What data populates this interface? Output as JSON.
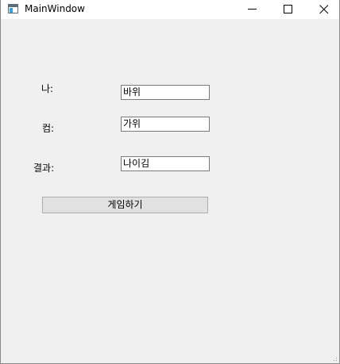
{
  "window": {
    "title": "MainWindow",
    "minimize_glyph": "minimize-icon",
    "maximize_glyph": "maximize-icon",
    "close_glyph": "close-icon"
  },
  "form": {
    "me_label": "나:",
    "me_value": "바위",
    "computer_label": "컴:",
    "computer_value": "가위",
    "result_label": "결과:",
    "result_value": "나이김",
    "play_button": "게임하기"
  }
}
